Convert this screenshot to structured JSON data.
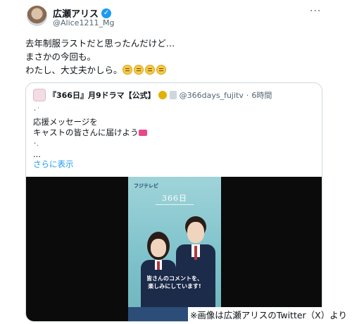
{
  "tweet": {
    "display_name": "広瀬アリス",
    "handle": "@Alice1211_Mg",
    "more_icon": "more-horizontal-icon",
    "verified_color": "#1d9bf0",
    "lines": [
      "去年制服ラストだと思ったんだけど…",
      "まさかの今回も。",
      "わたし、大丈夫かしら。"
    ]
  },
  "quote": {
    "account_name": "『366日』月9ドラマ【公式】",
    "handle": "@366days_fujitv",
    "time": "6時間",
    "meta_separator": "·",
    "lines": [
      "応援メッセージを",
      "キャストの皆さんに届けよう"
    ],
    "dots_top": "･˙",
    "dots_mid": "･.",
    "dots_bottom": "...",
    "show_more": "さらに表示"
  },
  "poster": {
    "logo": "フジテレビ",
    "title": "366日",
    "caption_line1": "皆さんのコメントを、",
    "caption_line2": "楽しみにしています!"
  },
  "credit": "※画像は広瀬アリスのTwitter（X）より"
}
